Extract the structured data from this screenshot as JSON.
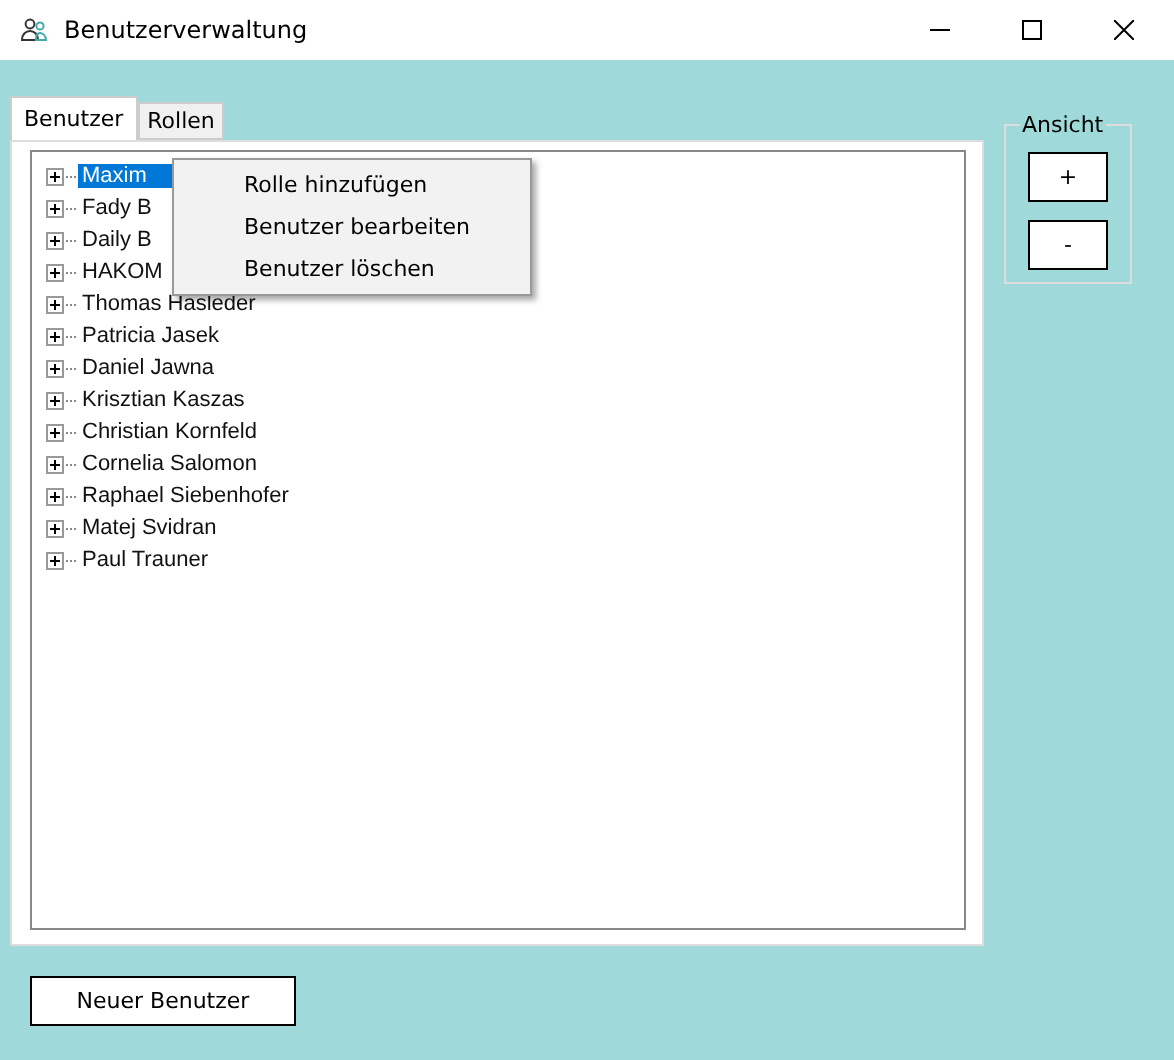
{
  "window": {
    "title": "Benutzerverwaltung"
  },
  "tabs": [
    {
      "label": "Benutzer",
      "selected": true
    },
    {
      "label": "Rollen",
      "selected": false
    }
  ],
  "tree": {
    "items": [
      {
        "label": "Maxim",
        "selected": true,
        "expanded": false
      },
      {
        "label": "Fady B",
        "selected": false,
        "expanded": false
      },
      {
        "label": "Daily B",
        "selected": false,
        "expanded": false
      },
      {
        "label": "HAKOM",
        "selected": false,
        "expanded": false
      },
      {
        "label": "Thomas Hasleder",
        "selected": false,
        "expanded": false
      },
      {
        "label": "Patricia Jasek",
        "selected": false,
        "expanded": false
      },
      {
        "label": "Daniel Jawna",
        "selected": false,
        "expanded": false
      },
      {
        "label": "Krisztian Kaszas",
        "selected": false,
        "expanded": false
      },
      {
        "label": "Christian Kornfeld",
        "selected": false,
        "expanded": false
      },
      {
        "label": "Cornelia Salomon",
        "selected": false,
        "expanded": false
      },
      {
        "label": "Raphael Siebenhofer",
        "selected": false,
        "expanded": false
      },
      {
        "label": "Matej Svidran",
        "selected": false,
        "expanded": false
      },
      {
        "label": "Paul Trauner",
        "selected": false,
        "expanded": false
      }
    ]
  },
  "context_menu": [
    "Rolle hinzufügen",
    "Benutzer bearbeiten",
    "Benutzer löschen"
  ],
  "view_group": {
    "title": "Ansicht",
    "buttons": [
      "+",
      "-"
    ]
  },
  "buttons": [
    "Neuer Benutzer"
  ]
}
